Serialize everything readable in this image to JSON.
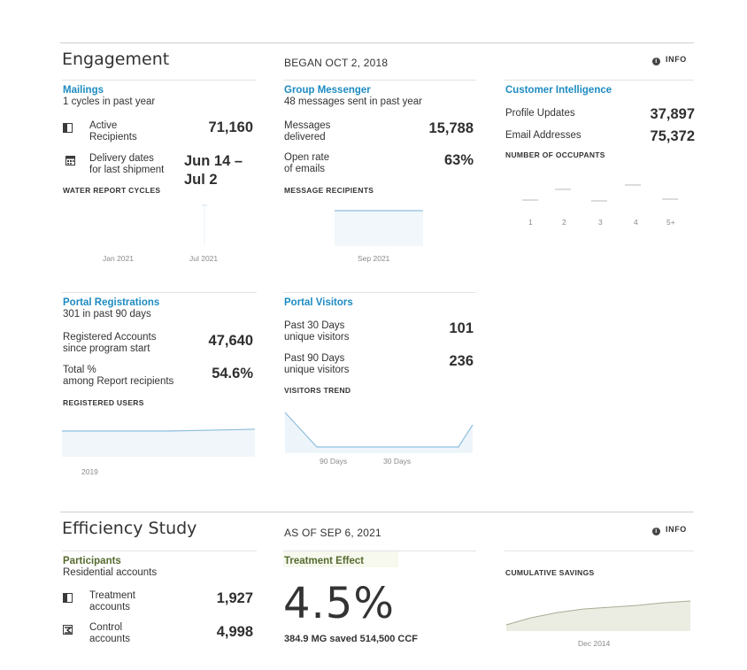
{
  "engagement": {
    "title": "Engagement",
    "began": "BEGAN OCT 2, 2018",
    "info": "INFO",
    "mailings": {
      "title": "Mailings",
      "subtitle": "1 cycles in past year",
      "active_label": "Active\nRecipients",
      "active_value": "71,160",
      "delivery_label": "Delivery dates\nfor last shipment",
      "delivery_value_1": "Jun 14 –",
      "delivery_value_2": "Jul 2",
      "chart_label": "WATER REPORT CYCLES",
      "axis": [
        "Jan 2021",
        "Jul 2021"
      ]
    },
    "group_messenger": {
      "title": "Group Messenger",
      "subtitle": "48 messages sent in past year",
      "delivered_label": "Messages\ndelivered",
      "delivered_value": "15,788",
      "open_label": "Open rate\nof emails",
      "open_value": "63%",
      "chart_label": "MESSAGE RECIPIENTS",
      "axis": [
        "Sep 2021"
      ]
    },
    "customer_intelligence": {
      "title": "Customer Intelligence",
      "profile_label": "Profile Updates",
      "profile_value": "37,897",
      "email_label": "Email Addresses",
      "email_value": "75,372",
      "chart_label": "NUMBER OF OCCUPANTS",
      "axis": [
        "1",
        "2",
        "3",
        "4",
        "5+"
      ]
    },
    "portal_registrations": {
      "title": "Portal Registrations",
      "subtitle": "301 in past 90 days",
      "registered_label": "Registered Accounts\nsince program start",
      "registered_value": "47,640",
      "total_label": "Total %\namong Report recipients",
      "total_value": "54.6%",
      "chart_label": "REGISTERED USERS",
      "axis": [
        "2019"
      ]
    },
    "portal_visitors": {
      "title": "Portal Visitors",
      "p30_label": "Past 30 Days\nunique visitors",
      "p30_value": "101",
      "p90_label": "Past 90 Days\nunique visitors",
      "p90_value": "236",
      "chart_label": "VISITORS TREND",
      "axis": [
        "90 Days",
        "30 Days"
      ]
    }
  },
  "efficiency": {
    "title": "Efficiency Study",
    "as_of": "AS OF SEP 6, 2021",
    "info": "INFO",
    "participants": {
      "title": "Participants",
      "subtitle": "Residential accounts",
      "treatment_label": "Treatment\naccounts",
      "treatment_value": "1,927",
      "control_label": "Control\naccounts",
      "control_value": "4,998"
    },
    "treatment_effect": {
      "title": "Treatment Effect",
      "value": "4.5%",
      "detail": "384.9 MG saved 514,500 CCF"
    },
    "savings": {
      "chart_label": "CUMULATIVE SAVINGS",
      "axis": [
        "Dec 2014"
      ]
    }
  },
  "colors": {
    "blue_title": "#1d8bc2",
    "green_title": "#556b2f",
    "chart_fill_blue": "#e6f1f8",
    "chart_fill_green": "#e9eadf"
  }
}
